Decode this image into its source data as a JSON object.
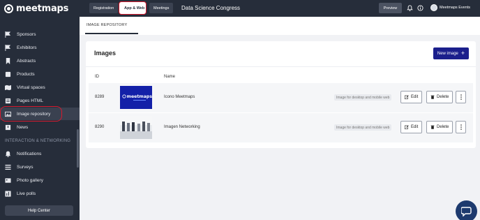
{
  "brand": {
    "logo_text": "meetmaps"
  },
  "sidebar": {
    "items": [
      {
        "label": "Sponsors",
        "icon": "flag-icon"
      },
      {
        "label": "Exhibitors",
        "icon": "flag-icon"
      },
      {
        "label": "Abstracts",
        "icon": "bookmark-icon"
      },
      {
        "label": "Products",
        "icon": "tag-icon"
      },
      {
        "label": "Virtual spaces",
        "icon": "map-icon"
      },
      {
        "label": "Pages HTML",
        "icon": "code-icon"
      },
      {
        "label": "Image repository",
        "icon": "image-icon",
        "active": true
      },
      {
        "label": "News",
        "icon": "news-icon"
      }
    ],
    "section_label": "INTERACTION & NETWORKING",
    "section_items": [
      {
        "label": "Notifications",
        "icon": "bell-icon"
      },
      {
        "label": "Surveys",
        "icon": "list-icon"
      },
      {
        "label": "Photo gallery",
        "icon": "photo-icon"
      },
      {
        "label": "Live polls",
        "icon": "poll-icon"
      }
    ],
    "help_label": "Help Center"
  },
  "topbar": {
    "tabs": [
      "Registration",
      "App & Web",
      "Meetings"
    ],
    "active_tab": "App & Web",
    "event_name": "Data Science Congress",
    "preview_label": "Preview",
    "org_name": "Meetmaps Events"
  },
  "subtab": {
    "label": "IMAGE REPOSITORY"
  },
  "images_card": {
    "title": "Images",
    "new_button_label": "New image",
    "columns": {
      "id": "ID",
      "name": "Name"
    },
    "rows": [
      {
        "id": "8289",
        "name": "Icono Meetmaps",
        "badge": "Image for desktop and mobile web",
        "thumb_text": "meetmaps"
      },
      {
        "id": "8290",
        "name": "Imagen Networking",
        "badge": "Image for desktop and mobile web"
      }
    ],
    "edit_label": "Edit",
    "delete_label": "Delete"
  },
  "colors": {
    "accent": "#1b1f8c",
    "sidebar_bg": "#262d3a",
    "highlight": "#d71a2e"
  }
}
